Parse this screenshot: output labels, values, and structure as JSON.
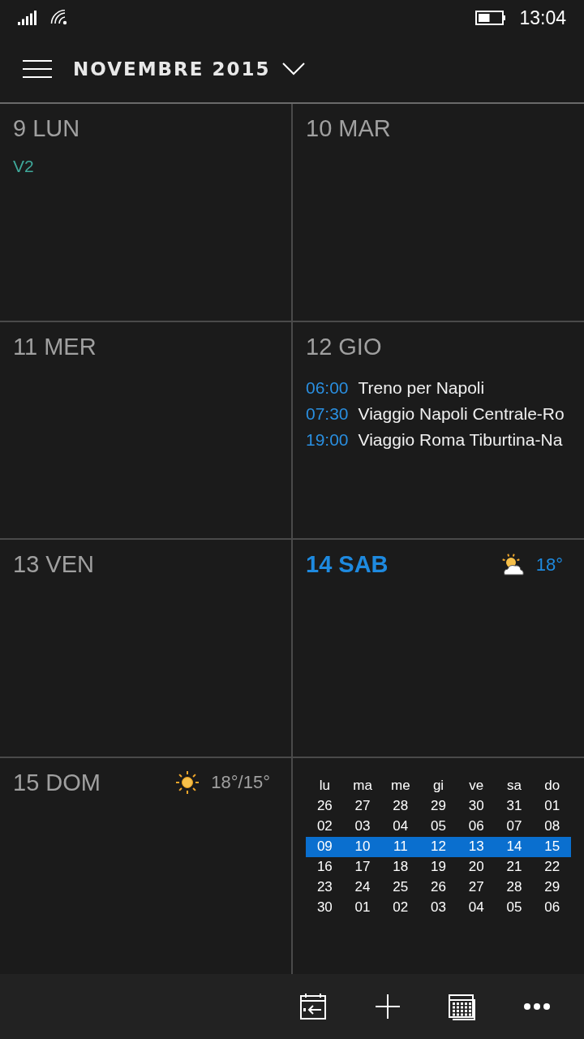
{
  "status_bar": {
    "time": "13:04"
  },
  "header": {
    "title": "NOVEMBRE 2015"
  },
  "cells": [
    {
      "kind": "day",
      "label": "9 LUN",
      "today": false,
      "all_day": [
        {
          "title": "V2",
          "color": "#3fa89a"
        }
      ]
    },
    {
      "kind": "day",
      "label": "10 MAR",
      "today": false
    },
    {
      "kind": "day",
      "label": "11 MER",
      "today": false
    },
    {
      "kind": "day",
      "label": "12 GIO",
      "today": false,
      "events": [
        {
          "time": "06:00",
          "title": "Treno per Napoli"
        },
        {
          "time": "07:30",
          "title": "Viaggio Napoli Centrale-Ro"
        },
        {
          "time": "19:00",
          "title": "Viaggio Roma Tiburtina-Na"
        }
      ]
    },
    {
      "kind": "day",
      "label": "13 VEN",
      "today": false
    },
    {
      "kind": "day",
      "label": "14 SAB",
      "today": true,
      "weather": {
        "kind": "partly_cloudy",
        "temp": "18°"
      }
    },
    {
      "kind": "day",
      "label": "15 DOM",
      "today": false,
      "weather": {
        "kind": "sunny",
        "temp": "18°/15°"
      }
    },
    {
      "kind": "mini_calendar",
      "weekdays": [
        "lu",
        "ma",
        "me",
        "gi",
        "ve",
        "sa",
        "do"
      ],
      "weeks": [
        {
          "selected": false,
          "days": [
            "26",
            "27",
            "28",
            "29",
            "30",
            "31",
            "01"
          ]
        },
        {
          "selected": false,
          "days": [
            "02",
            "03",
            "04",
            "05",
            "06",
            "07",
            "08"
          ]
        },
        {
          "selected": true,
          "days": [
            "09",
            "10",
            "11",
            "12",
            "13",
            "14",
            "15"
          ]
        },
        {
          "selected": false,
          "days": [
            "16",
            "17",
            "18",
            "19",
            "20",
            "21",
            "22"
          ]
        },
        {
          "selected": false,
          "days": [
            "23",
            "24",
            "25",
            "26",
            "27",
            "28",
            "29"
          ]
        },
        {
          "selected": false,
          "days": [
            "30",
            "01",
            "02",
            "03",
            "04",
            "05",
            "06"
          ]
        }
      ]
    }
  ],
  "app_bar": [
    {
      "kind": "today"
    },
    {
      "kind": "add"
    },
    {
      "kind": "month"
    },
    {
      "kind": "more"
    }
  ]
}
